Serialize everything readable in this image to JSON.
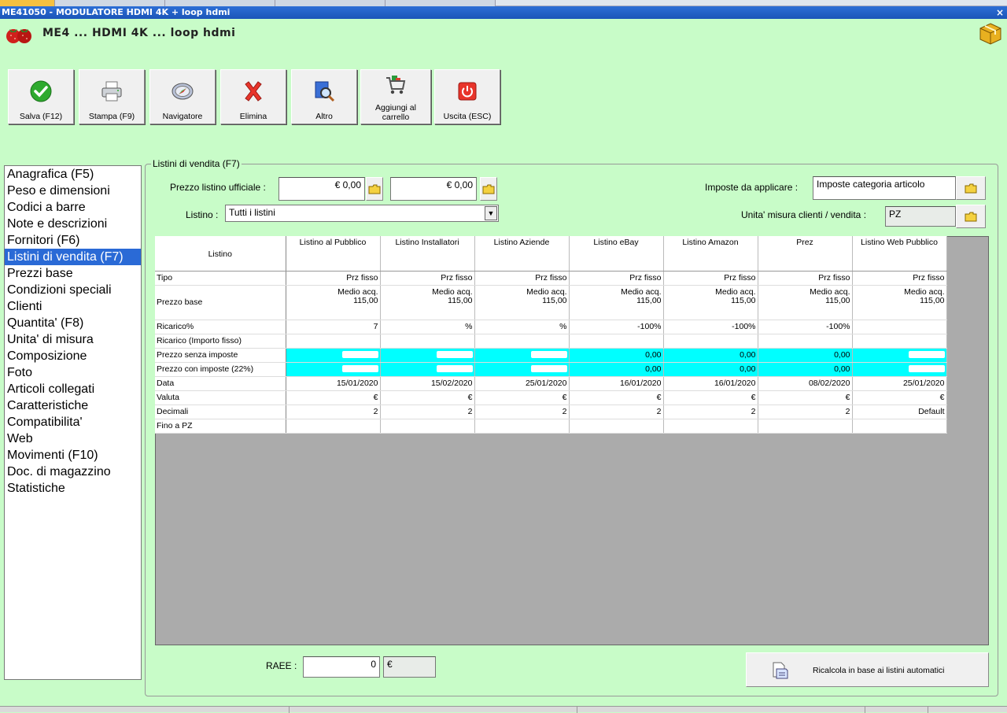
{
  "window": {
    "title": "ME41050 - MODULATORE HDMI 4K + loop hdmi",
    "close_glyph": "×"
  },
  "header": {
    "title": "ME4 ... HDMI 4K ... loop hdmi"
  },
  "toolbar": {
    "save": "Salva (F12)",
    "print": "Stampa (F9)",
    "navigator": "Navigatore",
    "delete": "Elimina",
    "other": "Altro",
    "cart_line1": "Aggiungi al",
    "cart_line2": "carrello",
    "exit": "Uscita (ESC)"
  },
  "sidebar": {
    "items": [
      "Anagrafica (F5)",
      "Peso e dimensioni",
      "Codici a barre",
      "Note e descrizioni",
      "Fornitori (F6)",
      "Listini di vendita (F7)",
      "Prezzi base",
      "Condizioni speciali",
      "Clienti",
      "Quantita' (F8)",
      "Unita' di misura",
      "Composizione",
      "Foto",
      "Articoli collegati",
      "Caratteristiche",
      "Compatibilita'",
      "Web",
      "Movimenti (F10)",
      "Doc. di magazzino",
      "Statistiche"
    ],
    "selected_index": 5
  },
  "panel": {
    "legend": "Listini di vendita (F7)",
    "official_price_label": "Prezzo listino ufficiale :",
    "official_price_1": "€ 0,00",
    "official_price_2": "€ 0,00",
    "list_label": "Listino :",
    "list_value": "Tutti i listini",
    "taxes_label": "Imposte da applicare :",
    "taxes_value": "Imposte categoria articolo",
    "unit_label": "Unita' misura clienti / vendita :",
    "unit_value": "PZ"
  },
  "grid": {
    "corner": "Listino",
    "columns": [
      "Listino al Pubblico",
      "Listino Installatori",
      "Listino Aziende",
      "Listino eBay",
      "Listino Amazon",
      "Prez",
      "Listino Web Pubblico"
    ],
    "rows": {
      "tipo": {
        "label": "Tipo",
        "values": [
          "Prz fisso",
          "Prz fisso",
          "Prz fisso",
          "Prz fisso",
          "Prz fisso",
          "Prz fisso",
          "Prz fisso"
        ]
      },
      "prezzo_base": {
        "label": "Prezzo base",
        "line1": "Medio acq.",
        "line2": "115,00"
      },
      "ricarico": {
        "label": "Ricarico%",
        "values": [
          "7",
          "%",
          "%",
          "-100%",
          "-100%",
          "-100%",
          ""
        ]
      },
      "ricarico_fisso": {
        "label": "Ricarico (Importo fisso)"
      },
      "senza_imposte": {
        "label": "Prezzo senza imposte",
        "values": [
          "",
          "",
          "",
          "0,00",
          "0,00",
          "0,00",
          ""
        ]
      },
      "con_imposte": {
        "label": "Prezzo con imposte (22%)",
        "values": [
          "",
          "",
          "",
          "0,00",
          "0,00",
          "0,00",
          ""
        ]
      },
      "data": {
        "label": "Data",
        "values": [
          "15/01/2020",
          "15/02/2020",
          "25/01/2020",
          "16/01/2020",
          "16/01/2020",
          "08/02/2020",
          "25/01/2020"
        ]
      },
      "valuta": {
        "label": "Valuta",
        "values": [
          "€",
          "€",
          "€",
          "€",
          "€",
          "€",
          "€"
        ]
      },
      "decimali": {
        "label": "Decimali",
        "values": [
          "2",
          "2",
          "2",
          "2",
          "2",
          "2",
          "Default"
        ]
      },
      "fino": {
        "label": "Fino a PZ"
      }
    }
  },
  "bottom": {
    "raee_label": "RAEE :",
    "raee_value": "0",
    "raee_currency": "€",
    "recalc": "Ricalcola in base ai listini automatici"
  },
  "colors": {
    "background": "#c8fcc8",
    "selection": "#2a6ad6",
    "highlight_row": "#00ffff"
  }
}
